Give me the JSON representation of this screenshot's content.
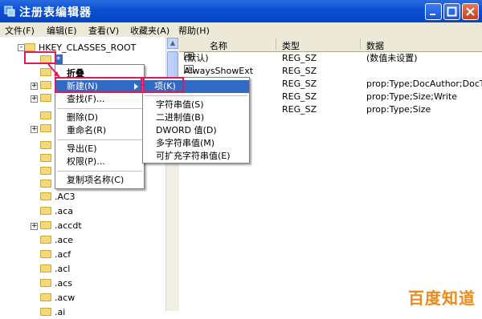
{
  "window": {
    "title": "注册表编辑器",
    "colors": {
      "titlebar": "#0a4fd0",
      "selection": "#316ac5",
      "highlight_box": "#e0195a"
    }
  },
  "menubar": [
    "文件(F)",
    "编辑(E)",
    "查看(V)",
    "收藏夹(A)",
    "帮助(H)"
  ],
  "tree": {
    "root": "HKEY_CLASSES_ROOT",
    "selected_key": "*",
    "items": [
      ".AC3",
      ".aca",
      ".accdt",
      ".ace",
      ".acf",
      ".acl",
      ".acs",
      ".acw",
      ".ai"
    ]
  },
  "values_panel": {
    "headers": {
      "name": "名称",
      "type": "类型",
      "data": "数据"
    },
    "rows": [
      {
        "name": "(默认)",
        "type": "REG_SZ",
        "data": "(数值未设置)"
      },
      {
        "name": "AlwaysShowExt",
        "type": "REG_SZ",
        "data": ""
      },
      {
        "name": "",
        "type": "REG_SZ",
        "data": "prop:Type;DocAuthor;DocT"
      },
      {
        "name": "",
        "type": "REG_SZ",
        "data": "prop:Type;Size;Write"
      },
      {
        "name": "",
        "type": "REG_SZ",
        "data": "prop:Type;Size"
      }
    ]
  },
  "context_menu": {
    "items": {
      "collapse": "折叠",
      "new": "新建(N)",
      "find": "查找(F)...",
      "delete": "删除(D)",
      "rename": "重命名(R)",
      "export": "导出(E)",
      "permissions": "权限(P)...",
      "copy_key_name": "复制项名称(C)"
    }
  },
  "submenu": {
    "items": {
      "key": "项(K)",
      "string": "字符串值(S)",
      "binary": "二进制值(B)",
      "dword": "DWORD 值(D)",
      "multi_string": "多字符串值(M)",
      "expandable_string": "可扩充字符串值(E)"
    }
  },
  "watermark": "百度知道"
}
